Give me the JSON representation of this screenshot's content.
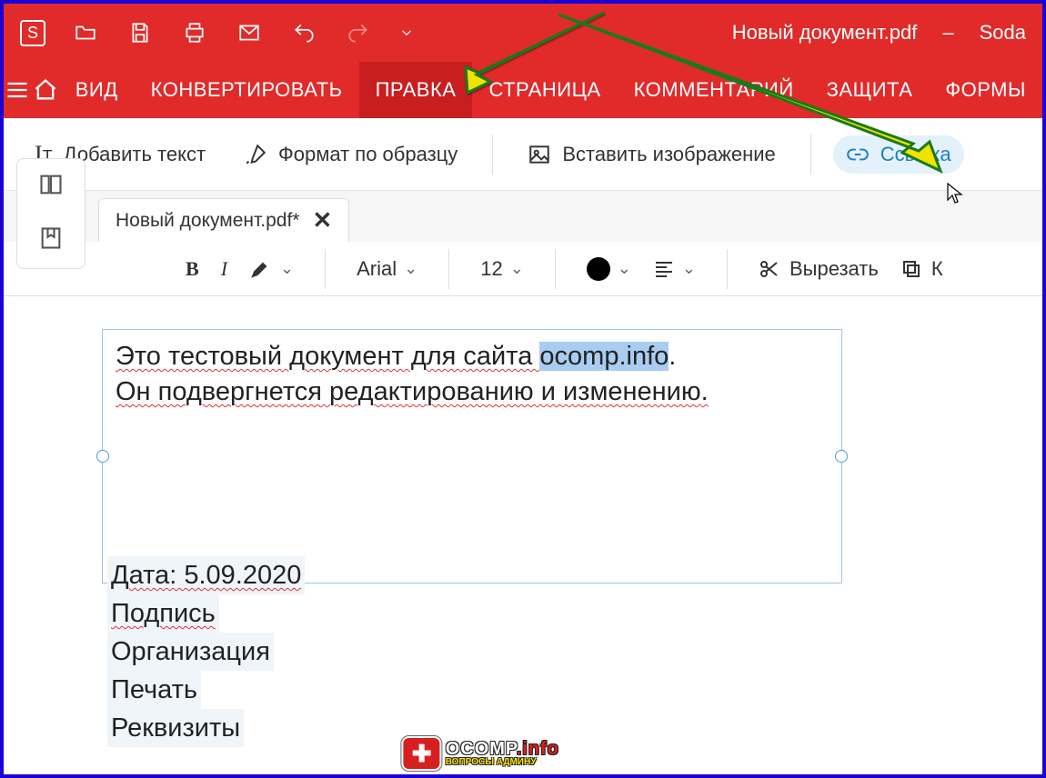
{
  "window": {
    "title": "Новый документ.pdf",
    "app": "Soda"
  },
  "menu": {
    "items": [
      "ВИД",
      "КОНВЕРТИРОВАТЬ",
      "ПРАВКА",
      "СТРАНИЦА",
      "КОММЕНТАРИЙ",
      "ЗАЩИТА",
      "ФОРМЫ"
    ],
    "active_index": 2
  },
  "edit_tools": {
    "add_text": "Добавить текст",
    "format_painter": "Формат по образцу",
    "insert_image": "Вставить изображение",
    "link": "Ссылка"
  },
  "tab": {
    "label": "Новый документ.pdf*"
  },
  "format_bar": {
    "font": "Arial",
    "size": "12",
    "cut": "Вырезать",
    "copy_initial": "К"
  },
  "document": {
    "line1_a": "Это тестовый документ для сайта ",
    "line1_sel": "ocomp.info",
    "line1_b": ".",
    "line2": "Он подвергнется редактированию и изменению.",
    "fields": [
      "Дата: 5.09.2020",
      "Подпись",
      "Организация",
      "Печать",
      "Реквизиты"
    ]
  },
  "watermark": {
    "site": "OCOMP",
    "tld": ".info",
    "tagline": "ВОПРОСЫ АДМИНУ"
  },
  "appbadge": "S"
}
